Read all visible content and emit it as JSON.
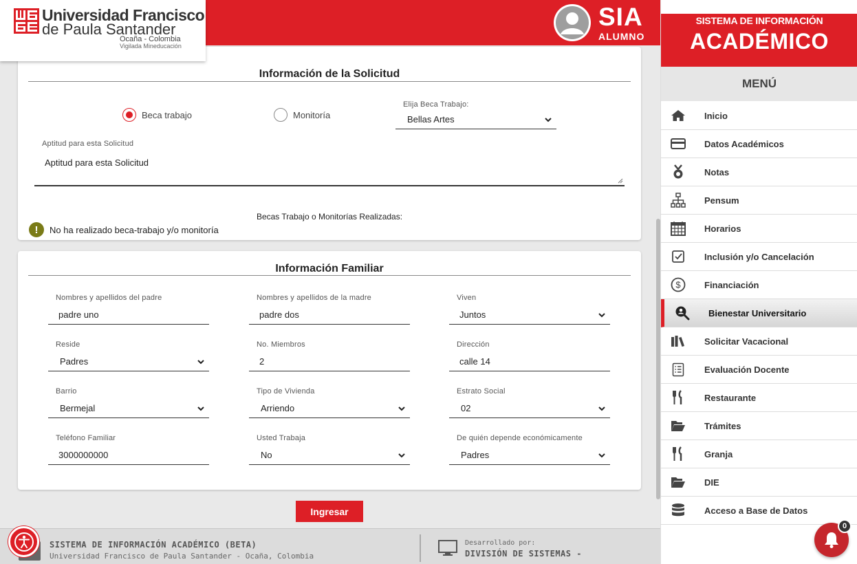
{
  "header": {
    "university_line1": "Universidad Francisco",
    "university_line2": "de Paula Santander",
    "university_city": "Ocaña - Colombia",
    "university_vigilada": "Vigilada Mineducación",
    "app_title": "SIA",
    "app_role": "ALUMNO"
  },
  "solicitud": {
    "title": "Información de la Solicitud",
    "radio_beca": "Beca trabajo",
    "radio_monitoria": "Monitoría",
    "selected_radio": "Beca trabajo",
    "beca_label": "Elija Beca Trabajo:",
    "beca_value": "Bellas Artes",
    "aptitud_label": "Aptitud para esta Solicitud",
    "aptitud_value": "Aptitud para esta Solicitud",
    "realizadas_label": "Becas Trabajo o Monitorías Realizadas:",
    "notice_icon": "!",
    "notice_text": "No ha realizado beca-trabajo y/o monitoría"
  },
  "familiar": {
    "title": "Información Familiar",
    "padre_label": "Nombres y apellidos del padre",
    "padre_value": "padre uno",
    "madre_label": "Nombres y apellidos de la madre",
    "madre_value": "padre dos",
    "viven_label": "Viven",
    "viven_value": "Juntos",
    "reside_label": "Reside",
    "reside_value": "Padres",
    "miembros_label": "No. Miembros",
    "miembros_value": "2",
    "direccion_label": "Dirección",
    "direccion_value": "calle 14",
    "barrio_label": "Barrio",
    "barrio_value": "Bermejal",
    "vivienda_label": "Tipo de Vivienda",
    "vivienda_value": "Arriendo",
    "estrato_label": "Estrato Social",
    "estrato_value": "02",
    "telefono_label": "Teléfono Familiar",
    "telefono_value": "3000000000",
    "trabaja_label": "Usted Trabaja",
    "trabaja_value": "No",
    "depende_label": "De quién depende económicamente",
    "depende_value": "Padres"
  },
  "actions": {
    "ingresar_label": "Ingresar"
  },
  "footer": {
    "title": "SISTEMA DE INFORMACIÓN ACADÉMICO (BETA)",
    "subtitle": "Universidad Francisco de Paula Santander - Ocaña, Colombia",
    "dev_label": "Desarrollado por:",
    "dev_name": "DIVISIÓN DE SISTEMAS -"
  },
  "sidebar": {
    "subtitle": "SISTEMA DE INFORMACIÓN",
    "title": "ACADÉMICO",
    "menu_label": "MENÚ",
    "items": [
      {
        "label": "Inicio",
        "icon": "home-icon"
      },
      {
        "label": "Datos Académicos",
        "icon": "card-icon"
      },
      {
        "label": "Notas",
        "icon": "medal-icon"
      },
      {
        "label": "Pensum",
        "icon": "sitemap-icon"
      },
      {
        "label": "Horarios",
        "icon": "calendar-icon"
      },
      {
        "label": "Inclusión y/o Cancelación",
        "icon": "checkbox-icon"
      },
      {
        "label": "Financiación",
        "icon": "dollar-icon"
      },
      {
        "label": "Bienestar Universitario",
        "icon": "search-person-icon",
        "active": true
      },
      {
        "label": "Solicitar Vacacional",
        "icon": "books-icon"
      },
      {
        "label": "Evaluación Docente",
        "icon": "clipboard-icon"
      },
      {
        "label": "Restaurante",
        "icon": "utensils-icon"
      },
      {
        "label": "Trámites",
        "icon": "folder-open-icon"
      },
      {
        "label": "Granja",
        "icon": "utensils-icon"
      },
      {
        "label": "DIE",
        "icon": "folder-open-icon"
      },
      {
        "label": "Acceso a Base de Datos",
        "icon": "database-icon"
      }
    ]
  },
  "notifications": {
    "count": "0"
  },
  "colors": {
    "brand_red": "#dd1f26",
    "notice_olive": "#7a7b17"
  }
}
